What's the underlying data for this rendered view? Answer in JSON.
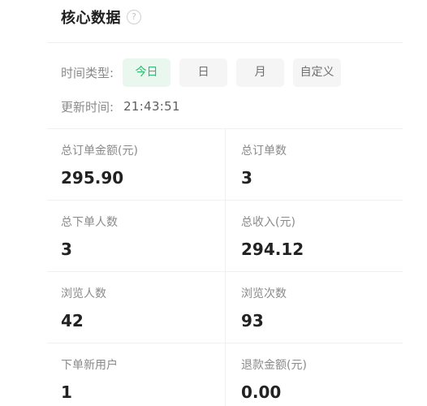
{
  "header": {
    "title": "核心数据",
    "help_icon": "question-circle-icon",
    "help_glyph": "?"
  },
  "filter": {
    "label": "时间类型:",
    "options": [
      "今日",
      "日",
      "月",
      "自定义"
    ],
    "selected": "今日"
  },
  "update": {
    "label": "更新时间:",
    "time": "21:43:51"
  },
  "metrics": [
    {
      "label": "总订单金额(元)",
      "value": "295.90"
    },
    {
      "label": "总订单数",
      "value": "3"
    },
    {
      "label": "总下单人数",
      "value": "3"
    },
    {
      "label": "总收入(元)",
      "value": "294.12"
    },
    {
      "label": "浏览人数",
      "value": "42"
    },
    {
      "label": "浏览次数",
      "value": "93"
    },
    {
      "label": "下单新用户",
      "value": "1"
    },
    {
      "label": "退款金额(元)",
      "value": "0.00"
    }
  ],
  "colors": {
    "accent": "#2fb86f",
    "accent_bg": "#e9f7ef",
    "muted_text": "#8a8a8a",
    "divider": "#f0f0f0"
  }
}
